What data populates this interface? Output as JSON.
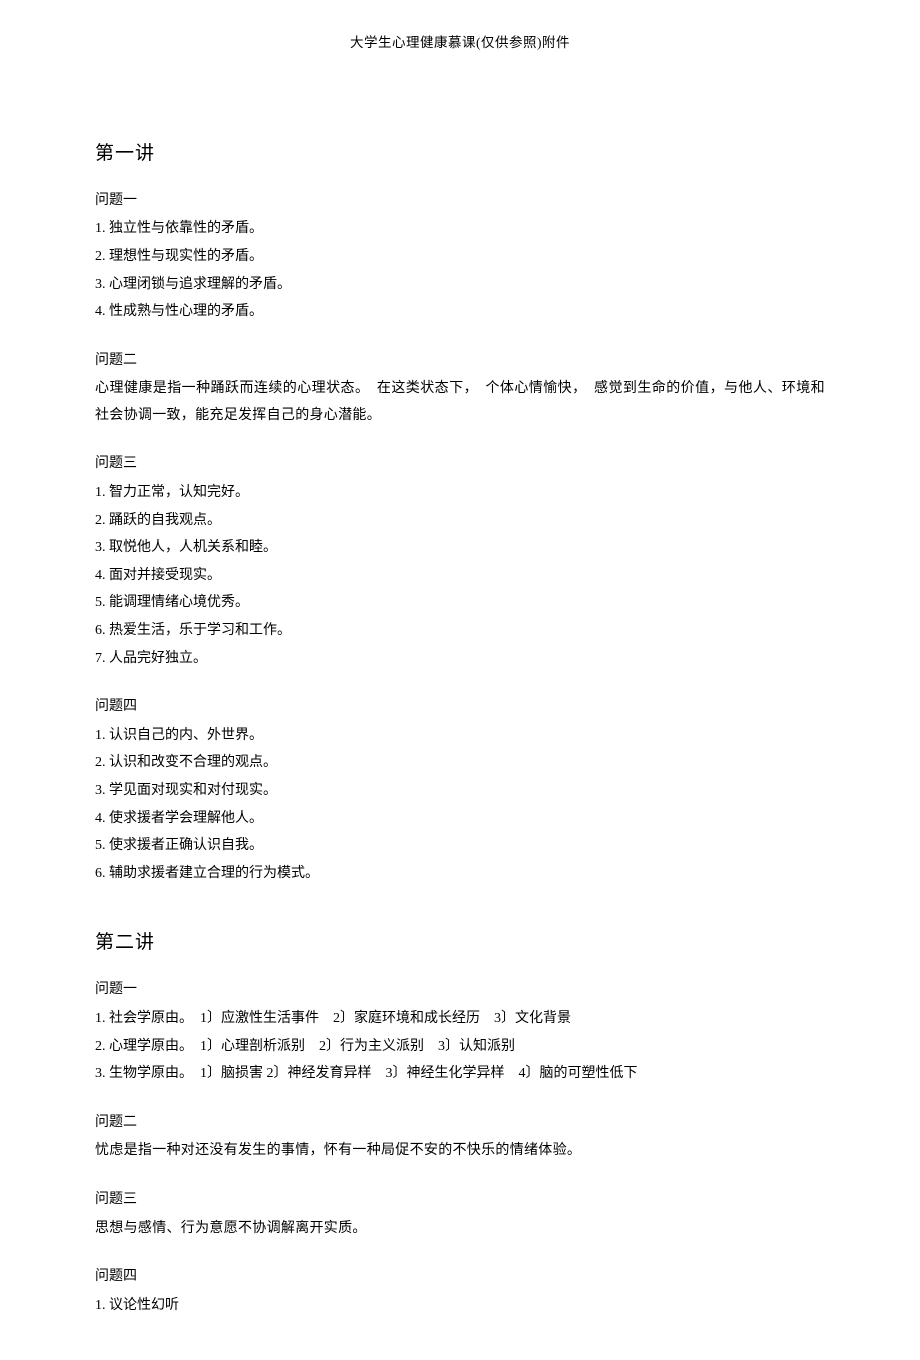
{
  "header": "大学生心理健康慕课(仅供参照)附件",
  "lecture1": {
    "title": "第一讲",
    "q1": {
      "label": "问题一",
      "items": [
        "1. 独立性与依靠性的矛盾。",
        "2. 理想性与现实性的矛盾。",
        "3. 心理闭锁与追求理解的矛盾。",
        "4. 性成熟与性心理的矛盾。"
      ]
    },
    "q2": {
      "label": "问题二",
      "text": "心理健康是指一种踊跃而连续的心理状态。　在这类状态下，　个体心情愉快，　感觉到生命的价值，与他人、环境和社会协调一致，能充足发挥自己的身心潜能。"
    },
    "q3": {
      "label": "问题三",
      "items": [
        "1. 智力正常，认知完好。",
        "2. 踊跃的自我观点。",
        "3. 取悦他人，人机关系和睦。",
        "4. 面对并接受现实。",
        "5. 能调理情绪心境优秀。",
        "6. 热爱生活，乐于学习和工作。",
        "7. 人品完好独立。"
      ]
    },
    "q4": {
      "label": "问题四",
      "items": [
        "1. 认识自己的内、外世界。",
        "2. 认识和改变不合理的观点。",
        "3. 学见面对现实和对付现实。",
        "4. 使求援者学会理解他人。",
        "5. 使求援者正确认识自我。",
        "6. 辅助求援者建立合理的行为模式。"
      ]
    }
  },
  "lecture2": {
    "title": "第二讲",
    "q1": {
      "label": "问题一",
      "items": [
        "1. 社会学原由。　1〕应激性生活事件　2〕家庭环境和成长经历　3〕文化背景",
        "2. 心理学原由。　1〕心理剖析派别　2〕行为主义派别　3〕认知派别",
        "3. 生物学原由。　1〕脑损害  2〕神经发育异样　3〕神经生化学异样　4〕脑的可塑性低下"
      ]
    },
    "q2": {
      "label": "问题二",
      "text": "忧虑是指一种对还没有发生的事情，怀有一种局促不安的不快乐的情绪体验。"
    },
    "q3": {
      "label": "问题三",
      "text": "思想与感情、行为意愿不协调解离开实质。"
    },
    "q4": {
      "label": "问题四",
      "items": [
        "1. 议论性幻听"
      ]
    }
  }
}
